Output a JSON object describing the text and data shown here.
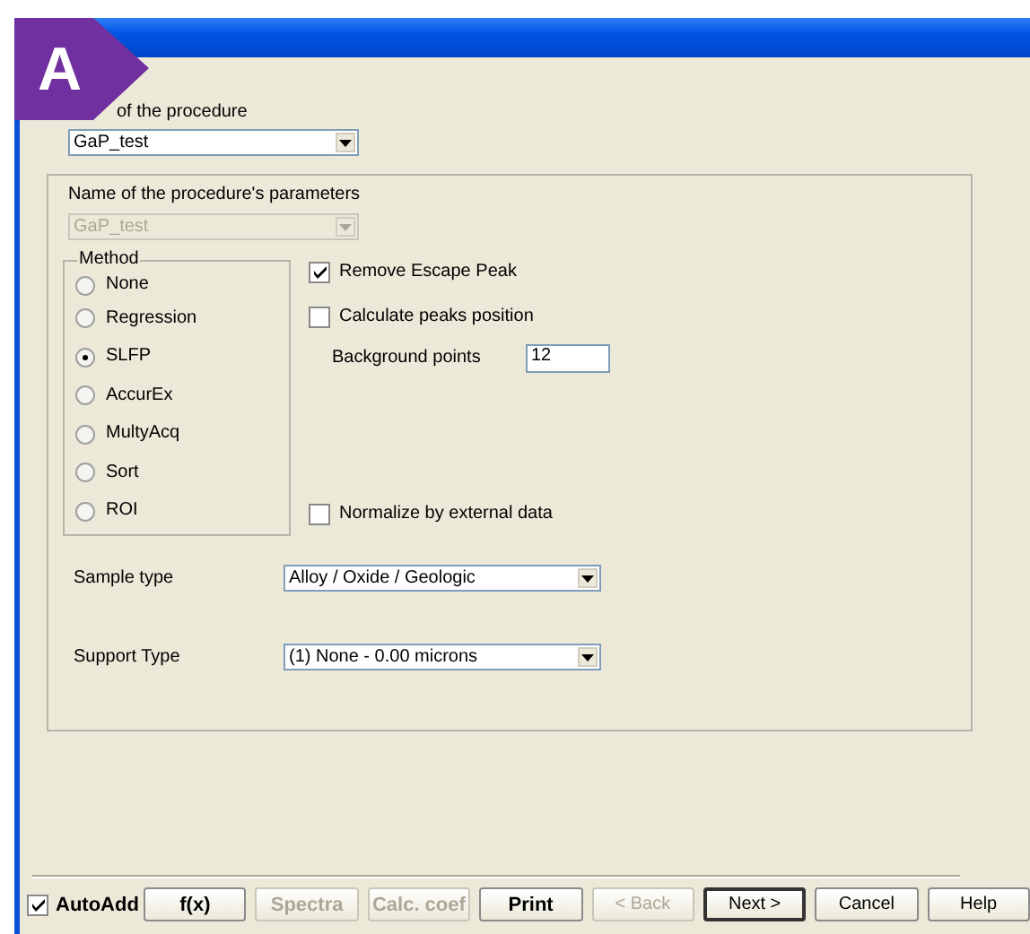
{
  "badge": {
    "text": "A"
  },
  "procedure": {
    "label": "of the procedure",
    "value": "GaP_test"
  },
  "parameters": {
    "label": "Name of the procedure's parameters",
    "value": "GaP_test",
    "disabled": true
  },
  "method": {
    "legend": "Method",
    "options": [
      {
        "label": "None",
        "selected": false
      },
      {
        "label": "Regression",
        "selected": false
      },
      {
        "label": "SLFP",
        "selected": true
      },
      {
        "label": "AccurEx",
        "selected": false
      },
      {
        "label": "MultyAcq",
        "selected": false
      },
      {
        "label": "Sort",
        "selected": false
      },
      {
        "label": "ROI",
        "selected": false
      }
    ]
  },
  "options": [
    {
      "kind": "checkbox",
      "label": "Remove Escape Peak",
      "checked": true
    },
    {
      "kind": "checkbox",
      "label": "Calculate peaks position",
      "checked": false
    },
    {
      "kind": "number",
      "label": "Background points",
      "value": "12"
    }
  ],
  "normalize": {
    "label": "Normalize by external data",
    "checked": false
  },
  "sample_type": {
    "label": "Sample type",
    "value": "Alloy / Oxide / Geologic"
  },
  "support_type": {
    "label": "Support Type",
    "value": "(1) None - 0.00 microns"
  },
  "auto_add": {
    "label": "AutoAdd",
    "checked": true
  },
  "buttons": [
    {
      "label": "f(x)",
      "bold": true,
      "disabled": false,
      "default": false
    },
    {
      "label": "Spectra",
      "bold": true,
      "disabled": true,
      "default": false
    },
    {
      "label": "Calc. coef",
      "bold": true,
      "disabled": true,
      "default": false
    },
    {
      "label": "Print",
      "bold": true,
      "disabled": false,
      "default": false
    },
    {
      "label": "< Back",
      "bold": false,
      "disabled": true,
      "default": false
    },
    {
      "label": "Next >",
      "bold": false,
      "disabled": false,
      "default": true
    },
    {
      "label": "Cancel",
      "bold": false,
      "disabled": false,
      "default": false
    },
    {
      "label": "Help",
      "bold": false,
      "disabled": false,
      "default": false
    }
  ]
}
